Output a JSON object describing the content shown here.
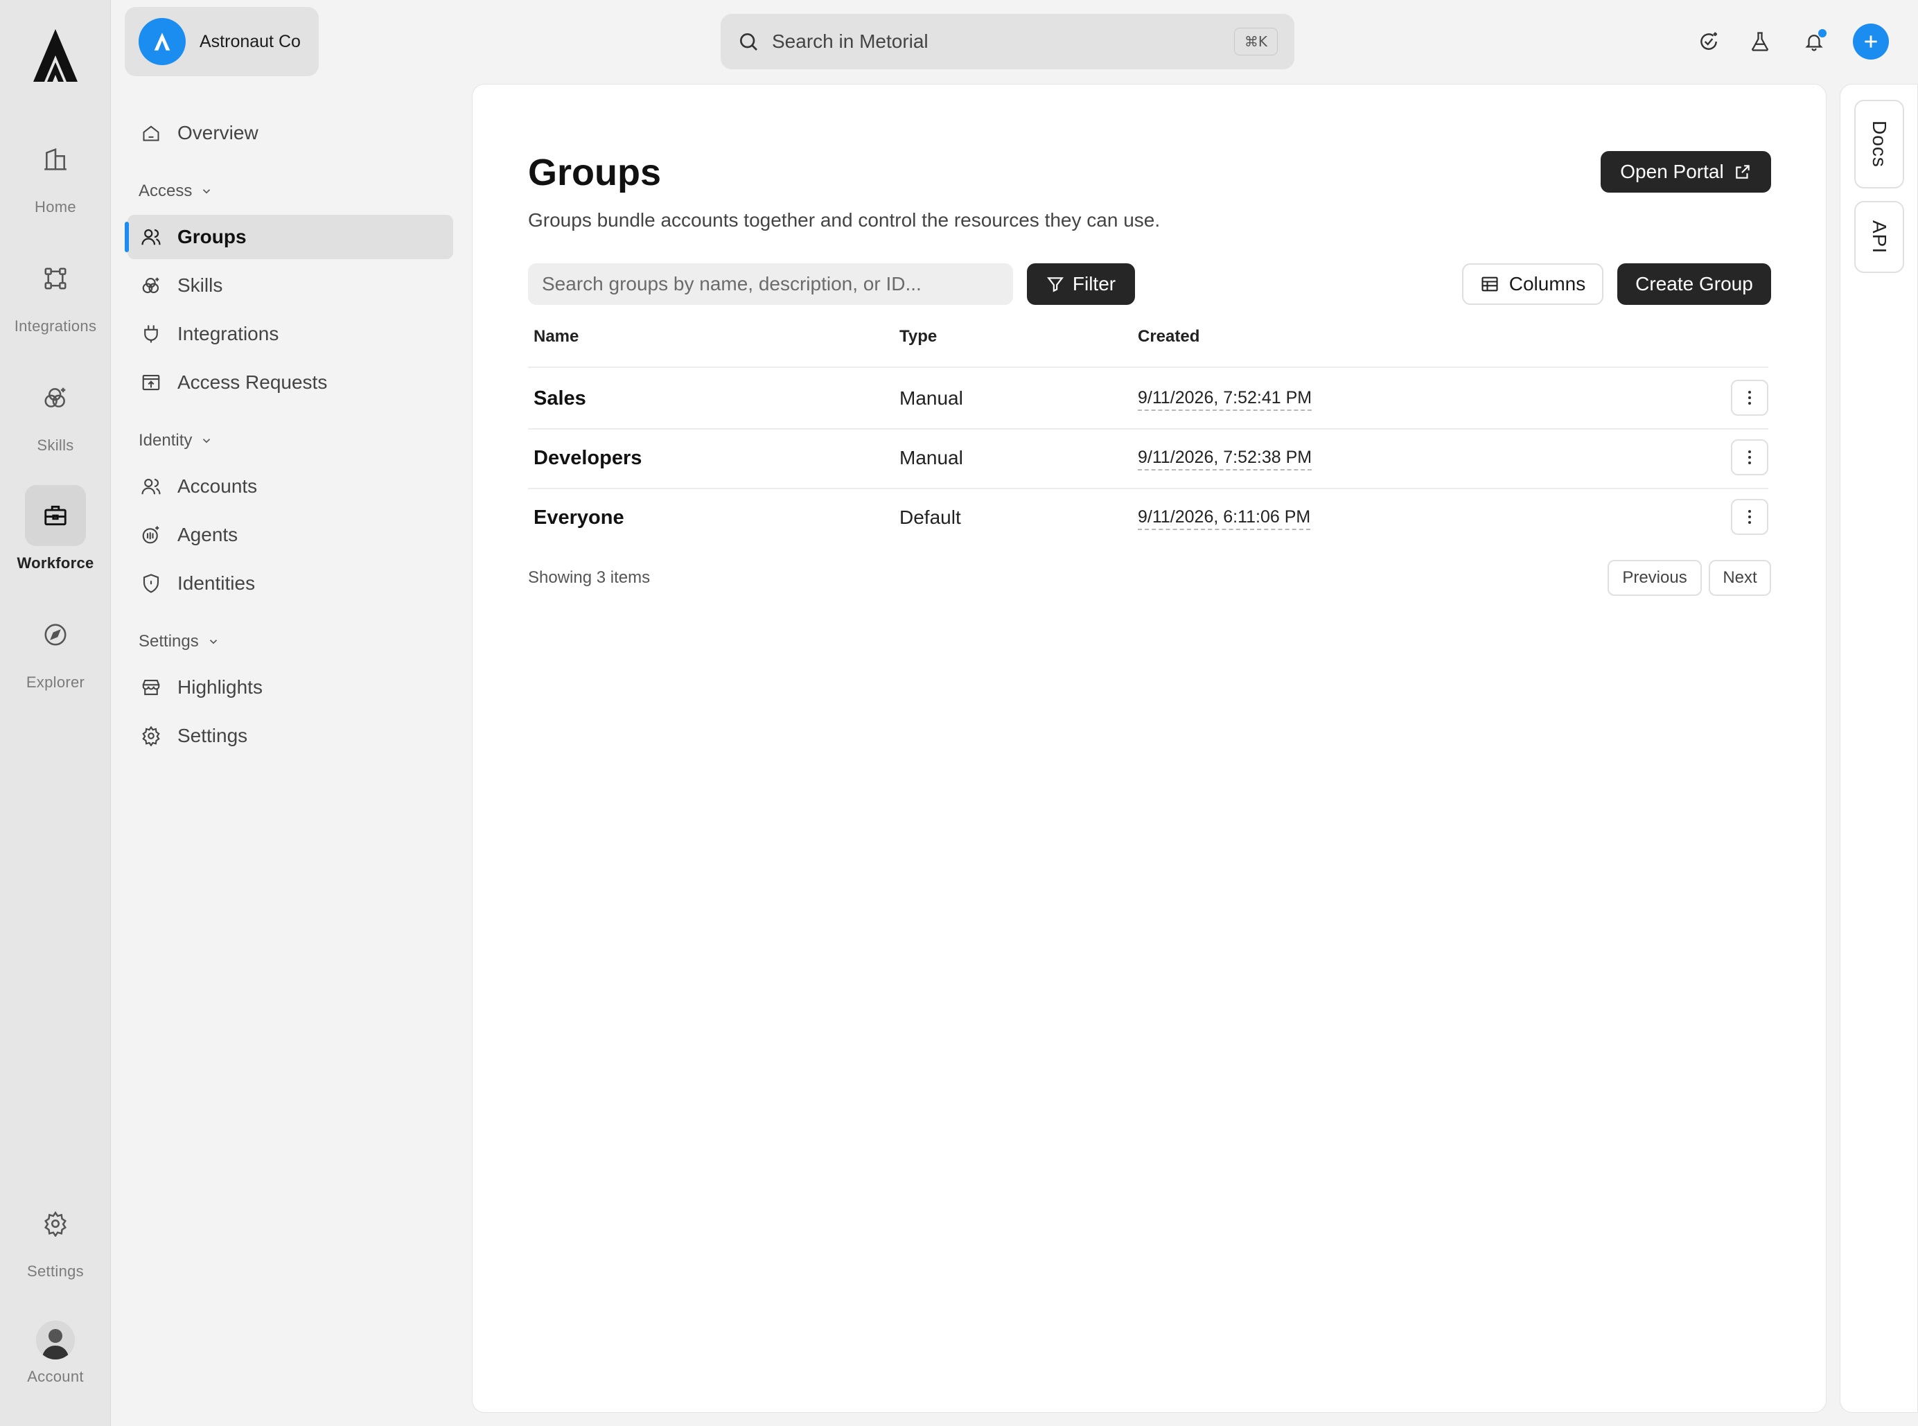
{
  "rail": {
    "items": [
      {
        "label": "Home",
        "icon": "building-icon"
      },
      {
        "label": "Integrations",
        "icon": "nodes-icon"
      },
      {
        "label": "Skills",
        "icon": "skills-icon"
      },
      {
        "label": "Workforce",
        "icon": "briefcase-icon",
        "active": true
      },
      {
        "label": "Explorer",
        "icon": "compass-icon"
      },
      {
        "label": "Settings",
        "icon": "gear-icon"
      },
      {
        "label": "Account",
        "icon": "avatar"
      }
    ]
  },
  "org": {
    "name": "Astronaut Co"
  },
  "sidebar": {
    "overview": "Overview",
    "sections": [
      {
        "label": "Access",
        "items": [
          "Groups",
          "Skills",
          "Integrations",
          "Access Requests"
        ]
      },
      {
        "label": "Identity",
        "items": [
          "Accounts",
          "Agents",
          "Identities"
        ]
      },
      {
        "label": "Settings",
        "items": [
          "Highlights",
          "Settings"
        ]
      }
    ],
    "active_item": "Groups"
  },
  "topbar": {
    "search_placeholder": "Search in Metorial",
    "shortcut": "⌘K"
  },
  "page": {
    "title": "Groups",
    "subtitle": "Groups bundle accounts together and control the resources they can use.",
    "open_portal": "Open Portal",
    "search_placeholder": "Search groups by name, description, or ID...",
    "filter": "Filter",
    "columns": "Columns",
    "create": "Create Group"
  },
  "table": {
    "headers": [
      "Name",
      "Type",
      "Created"
    ],
    "rows": [
      {
        "name": "Sales",
        "type": "Manual",
        "created": "9/11/2026, 7:52:41 PM"
      },
      {
        "name": "Developers",
        "type": "Manual",
        "created": "9/11/2026, 7:52:38 PM"
      },
      {
        "name": "Everyone",
        "type": "Default",
        "created": "9/11/2026, 6:11:06 PM"
      }
    ],
    "showing": "Showing 3 items",
    "previous": "Previous",
    "next": "Next"
  },
  "right_tabs": [
    "Docs",
    "API"
  ],
  "colors": {
    "accent": "#1b8cf0",
    "dark_button": "#262626"
  }
}
